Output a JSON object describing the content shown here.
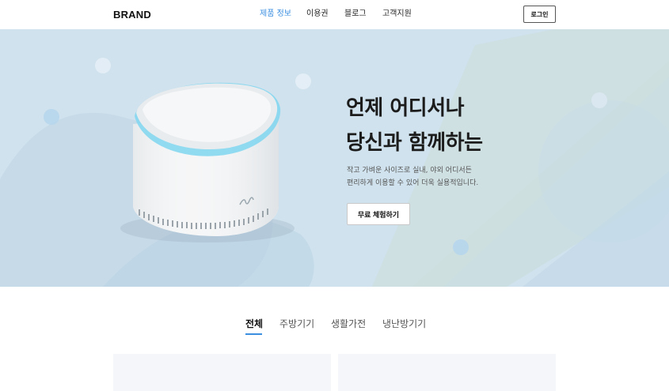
{
  "header": {
    "brand": "BRAND",
    "nav": [
      {
        "label": "제품 정보",
        "active": true
      },
      {
        "label": "이용권",
        "active": false
      },
      {
        "label": "블로그",
        "active": false
      },
      {
        "label": "고객지원",
        "active": false
      }
    ],
    "login_label": "로그인"
  },
  "hero": {
    "title_line1": "언제 어디서나",
    "title_line2": "당신과 함께하는",
    "desc_line1": "작고 가벼운 사이즈로 실내, 야외 어디서든",
    "desc_line2": "편리하게 이용할 수 있어 더욱 실용적입니다.",
    "cta_label": "무료 체험하기"
  },
  "tabs": [
    {
      "label": "전체",
      "active": true
    },
    {
      "label": "주방기기",
      "active": false
    },
    {
      "label": "생활가전",
      "active": false
    },
    {
      "label": "냉난방기기",
      "active": false
    }
  ],
  "colors": {
    "accent": "#3b8fe0",
    "hero_bg": "#cfe2ed"
  }
}
